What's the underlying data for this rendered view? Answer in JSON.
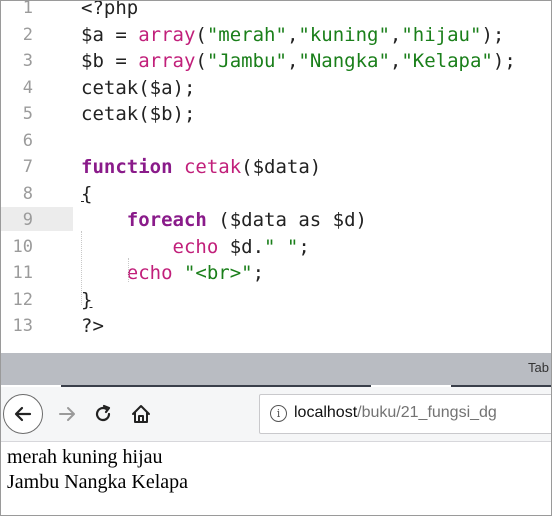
{
  "editor": {
    "lines": [
      {
        "num": "1",
        "segments": [
          {
            "t": "<?php",
            "c": "plain"
          }
        ]
      },
      {
        "num": "2",
        "segments": [
          {
            "t": "$a = ",
            "c": "plain"
          },
          {
            "t": "array",
            "c": "fn"
          },
          {
            "t": "(",
            "c": "plain"
          },
          {
            "t": "\"merah\"",
            "c": "str"
          },
          {
            "t": ",",
            "c": "plain"
          },
          {
            "t": "\"kuning\"",
            "c": "str"
          },
          {
            "t": ",",
            "c": "plain"
          },
          {
            "t": "\"hijau\"",
            "c": "str"
          },
          {
            "t": ");",
            "c": "plain"
          }
        ]
      },
      {
        "num": "3",
        "segments": [
          {
            "t": "$b = ",
            "c": "plain"
          },
          {
            "t": "array",
            "c": "fn"
          },
          {
            "t": "(",
            "c": "plain"
          },
          {
            "t": "\"Jambu\"",
            "c": "str"
          },
          {
            "t": ",",
            "c": "plain"
          },
          {
            "t": "\"Nangka\"",
            "c": "str"
          },
          {
            "t": ",",
            "c": "plain"
          },
          {
            "t": "\"Kelapa\"",
            "c": "str"
          },
          {
            "t": ");",
            "c": "plain"
          }
        ]
      },
      {
        "num": "4",
        "segments": [
          {
            "t": "cetak($a);",
            "c": "plain"
          }
        ]
      },
      {
        "num": "5",
        "segments": [
          {
            "t": "cetak($b);",
            "c": "plain"
          }
        ]
      },
      {
        "num": "6",
        "segments": []
      },
      {
        "num": "7",
        "segments": [
          {
            "t": "function ",
            "c": "kw"
          },
          {
            "t": "cetak",
            "c": "call"
          },
          {
            "t": "($data)",
            "c": "plain"
          }
        ]
      },
      {
        "num": "8",
        "segments": [
          {
            "t": "{",
            "c": "ul"
          }
        ]
      },
      {
        "num": "9",
        "segments": [
          {
            "t": "    ",
            "c": "plain"
          },
          {
            "t": "foreach",
            "c": "kw"
          },
          {
            "t": " ($data as $d)",
            "c": "plain"
          }
        ]
      },
      {
        "num": "10",
        "segments": [
          {
            "t": "        ",
            "c": "plain"
          },
          {
            "t": "echo",
            "c": "fn"
          },
          {
            "t": " $d.",
            "c": "plain"
          },
          {
            "t": "\" \"",
            "c": "str"
          },
          {
            "t": ";",
            "c": "plain"
          }
        ]
      },
      {
        "num": "11",
        "segments": [
          {
            "t": "    ",
            "c": "plain"
          },
          {
            "t": "echo",
            "c": "fn"
          },
          {
            "t": " ",
            "c": "plain"
          },
          {
            "t": "\"<br>\"",
            "c": "str"
          },
          {
            "t": ";",
            "c": "plain"
          }
        ]
      },
      {
        "num": "12",
        "segments": [
          {
            "t": "}",
            "c": "ul"
          }
        ]
      },
      {
        "num": "13",
        "segments": [
          {
            "t": "?>",
            "c": "plain"
          }
        ]
      }
    ]
  },
  "statusbar": {
    "tab_label": "Tab"
  },
  "browser": {
    "back_icon": "back-arrow-icon",
    "forward_icon": "forward-arrow-icon",
    "reload_icon": "reload-icon",
    "home_icon": "home-icon",
    "info_icon": "info-icon",
    "url_host": "localhost",
    "url_path": "/buku/21_fungsi_dg"
  },
  "page": {
    "output_lines": [
      "merah kuning hijau",
      "Jambu Nangka Kelapa"
    ]
  },
  "colors": {
    "string": "#1a7f1a",
    "function": "#c11f7a",
    "keyword": "#8a1b8a",
    "line_number": "#9b9b9b",
    "status_bar": "#b9bcc2"
  }
}
